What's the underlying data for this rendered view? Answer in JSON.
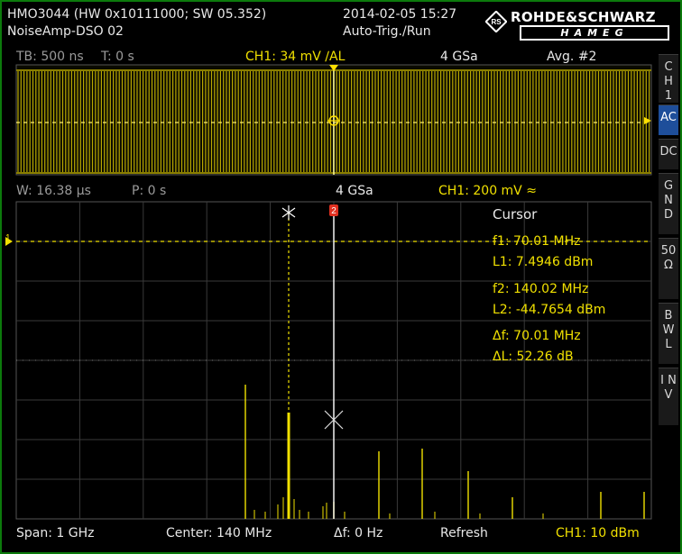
{
  "header": {
    "device": "HMO3044 (HW 0x10111000; SW 05.352)",
    "setup_name": "NoiseAmp-DSO 02",
    "datetime": "2014-02-05 15:27",
    "trigger_status": "Auto-Trig./Run",
    "brand_primary": "ROHDE&SCHWARZ",
    "brand_secondary": "HAMEG"
  },
  "time_bar": {
    "timebase": "TB: 500 ns",
    "trigger_time": "T: 0 s",
    "channel_setting": "CH1: 34 mV ∕AL",
    "sample_rate": "4 GSa",
    "acquisition": "Avg. #2"
  },
  "zoom_bar": {
    "window": "W: 16.38 µs",
    "position": "P: 0 s",
    "sample_rate": "4 GSa",
    "channel_setting": "CH1: 200 mV ≈"
  },
  "side_menu": [
    {
      "label": "C H 1",
      "active": false
    },
    {
      "label": "AC",
      "active": true
    },
    {
      "label": "DC",
      "active": false
    },
    {
      "label": "G N D",
      "active": false
    },
    {
      "label": "50 Ω",
      "active": false
    },
    {
      "label": "B W L",
      "active": false
    },
    {
      "label": "I N V",
      "active": false
    }
  ],
  "cursor_panel": {
    "title": "Cursor",
    "f1": "f1: 70.01 MHz",
    "l1": "L1: 7.4946 dBm",
    "f2": "f2: 140.02 MHz",
    "l2": "L2: -44.7654 dBm",
    "df": "Δf: 70.01 MHz",
    "dl": "ΔL: 52.26 dB"
  },
  "markers": {
    "channel_marker": "1",
    "cursor2_label": "2"
  },
  "bottom_bar": {
    "span": "Span: 1 GHz",
    "center": "Center: 140 MHz",
    "delta_f": "Δf: 0 Hz",
    "mode": "Refresh",
    "ch_ref": "CH1: 10 dBm"
  },
  "colors": {
    "trace": "#f0e000",
    "grid": "#3a3a3a",
    "active_button": "#1e4e9a",
    "frame": "#0c7a0c"
  }
}
